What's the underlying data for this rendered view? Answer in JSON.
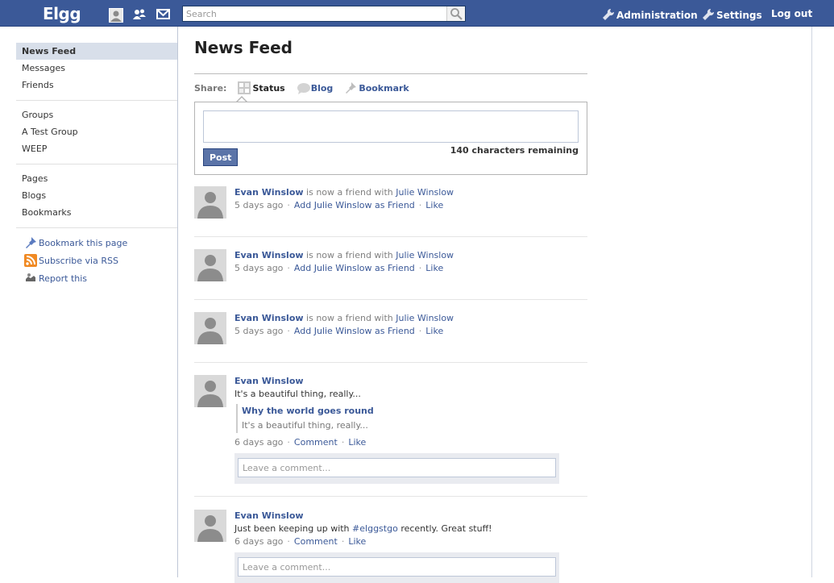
{
  "topbar": {
    "logo": "Elgg",
    "search_placeholder": "Search",
    "administration": "Administration",
    "settings": "Settings",
    "logout": "Log out"
  },
  "sidebar": {
    "group1": [
      "News Feed",
      "Messages",
      "Friends"
    ],
    "group2": [
      "Groups",
      "A Test Group",
      "WEEP"
    ],
    "group3": [
      "Pages",
      "Blogs",
      "Bookmarks"
    ],
    "tools": [
      "Bookmark this page",
      "Subscribe via RSS",
      "Report this"
    ]
  },
  "main": {
    "title": "News Feed",
    "share_label": "Share:",
    "tabs": [
      "Status",
      "Blog",
      "Bookmark"
    ],
    "remaining": "140 characters remaining",
    "post_label": "Post"
  },
  "feed": [
    {
      "actor": "Evan Winslow",
      "text": "is now a friend with",
      "target": "Julie Winslow",
      "time": "5 days ago",
      "action": "Add Julie Winslow as Friend",
      "like": "Like"
    },
    {
      "actor": "Evan Winslow",
      "text": "is now a friend with",
      "target": "Julie Winslow",
      "time": "5 days ago",
      "action": "Add Julie Winslow as Friend",
      "like": "Like"
    },
    {
      "actor": "Evan Winslow",
      "text": "is now a friend with",
      "target": "Julie Winslow",
      "time": "5 days ago",
      "action": "Add Julie Winslow as Friend",
      "like": "Like"
    },
    {
      "actor": "Evan Winslow",
      "message": "It's a beautiful thing, really...",
      "attach_title": "Why the world goes round",
      "attach_text": "It's a beautiful thing, really...",
      "time": "6 days ago",
      "comment": "Comment",
      "like": "Like",
      "comment_placeholder": "Leave a comment..."
    },
    {
      "actor": "Evan Winslow",
      "message_pre": "Just been keeping up with",
      "hashtag": "#elggstgo",
      "message_post": "recently. Great stuff!",
      "time": "6 days ago",
      "comment": "Comment",
      "like": "Like",
      "comment_placeholder": "Leave a comment..."
    }
  ],
  "colors": {
    "brand": "#3b5998",
    "accent_bg": "#d8dfea"
  }
}
